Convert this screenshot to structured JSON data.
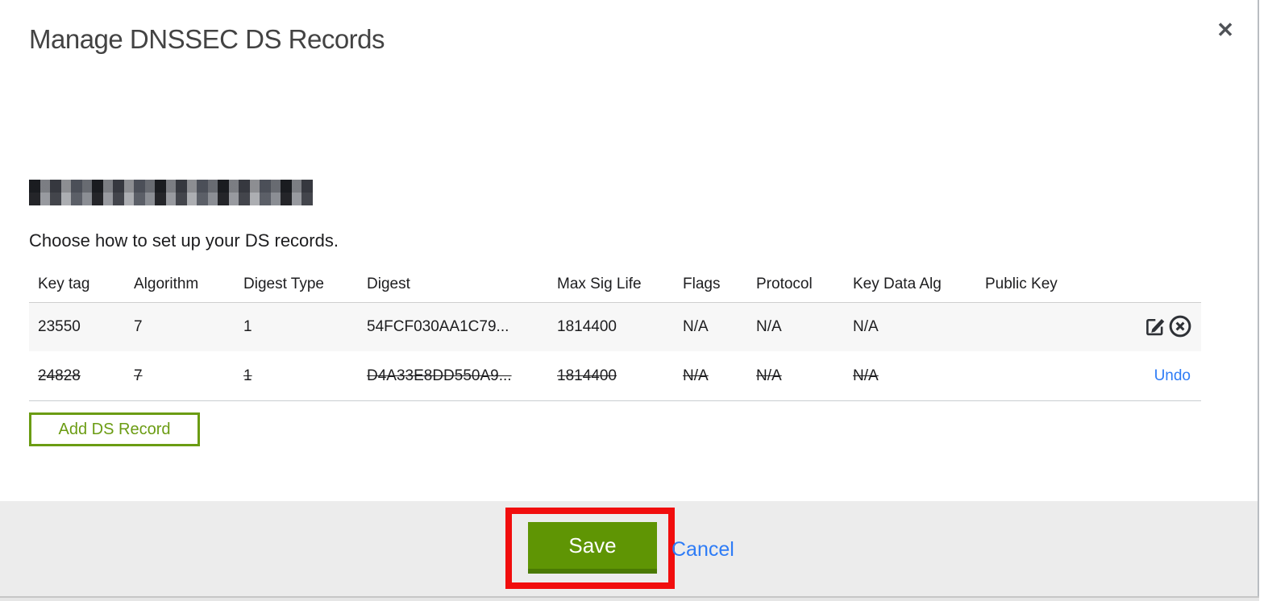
{
  "modal": {
    "title": "Manage DNSSEC DS Records",
    "instruction": "Choose how to set up your DS records.",
    "icons": {
      "close": "✕",
      "edit": "edit-pencil-square",
      "delete": "x-in-circle"
    },
    "table": {
      "columns": [
        "Key tag",
        "Algorithm",
        "Digest Type",
        "Digest",
        "Max Sig Life",
        "Flags",
        "Protocol",
        "Key Data Alg",
        "Public Key"
      ],
      "rows": [
        {
          "key_tag": "23550",
          "algorithm": "7",
          "digest_type": "1",
          "digest": "54FCF030AA1C79...",
          "max_sig_life": "1814400",
          "flags": "N/A",
          "protocol": "N/A",
          "key_data_alg": "N/A",
          "public_key": "",
          "state": "normal"
        },
        {
          "key_tag": "24828",
          "algorithm": "7",
          "digest_type": "1",
          "digest": "D4A33E8DD550A9...",
          "max_sig_life": "1814400",
          "flags": "N/A",
          "protocol": "N/A",
          "key_data_alg": "N/A",
          "public_key": "",
          "state": "deleted",
          "undo_label": "Undo"
        }
      ]
    },
    "add_button_label": "Add DS Record",
    "footer": {
      "save_label": "Save",
      "cancel_label": "Cancel"
    },
    "colors": {
      "save_green": "#5f9504",
      "add_button_green": "#6b9c13",
      "link_blue": "#2e7cf6",
      "annotation_red": "#f10d0d"
    }
  }
}
